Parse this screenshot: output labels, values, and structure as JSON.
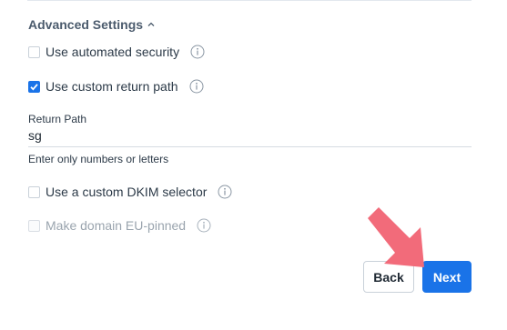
{
  "advanced_settings": {
    "title": "Advanced Settings",
    "expanded": true
  },
  "options": [
    {
      "label": "Use automated security",
      "checked": false,
      "disabled": false
    },
    {
      "label": "Use custom return path",
      "checked": true,
      "disabled": false
    }
  ],
  "return_path": {
    "label": "Return Path",
    "value": "sg",
    "helper": "Enter only numbers or letters"
  },
  "extra_options": [
    {
      "label": "Use a custom DKIM selector",
      "checked": false,
      "disabled": false
    },
    {
      "label": "Make domain EU-pinned",
      "checked": false,
      "disabled": true
    }
  ],
  "buttons": {
    "back": "Back",
    "next": "Next"
  },
  "colors": {
    "primary": "#1a73e8",
    "annotation_arrow": "#f26b7a"
  }
}
